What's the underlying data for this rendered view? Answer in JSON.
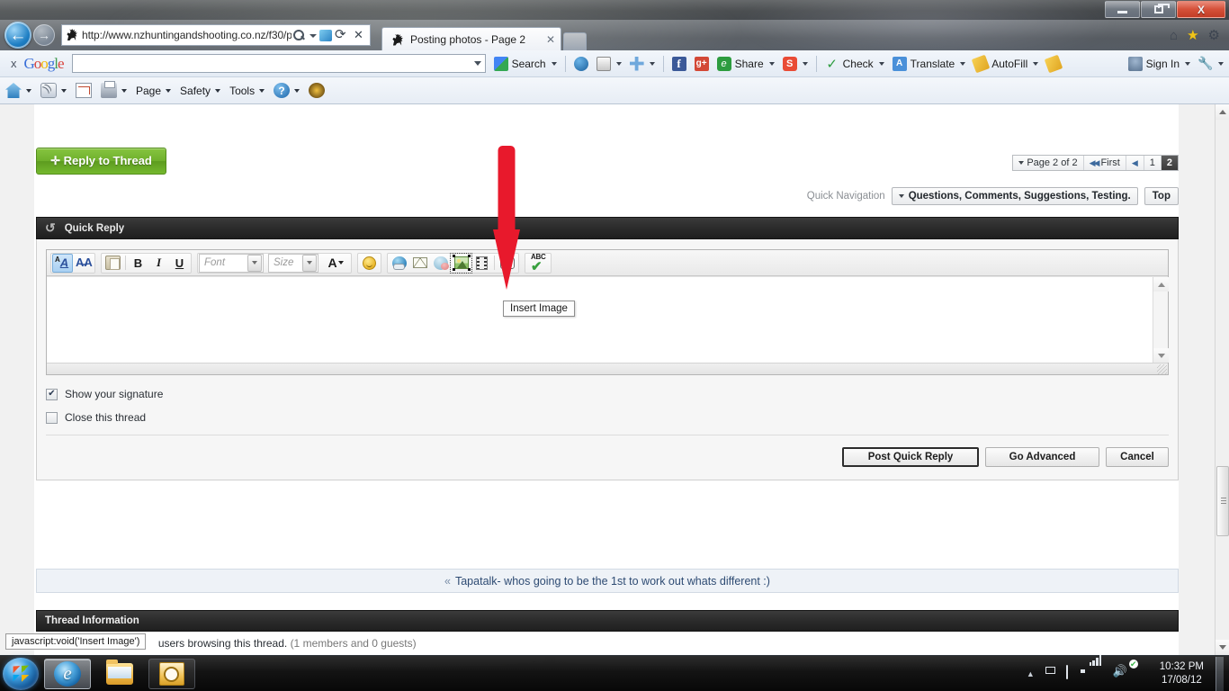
{
  "window": {
    "minimize_label": "Minimize",
    "restore_label": "Restore",
    "close_label": "X"
  },
  "browser": {
    "address_url": "http://www.nzhuntingandshooting.co.nz/f30/p",
    "address_domain": "nzhuntingandshooting.co.nz",
    "tab_title": "Posting photos - Page 2",
    "tab_close": "✕",
    "nav_back": "←",
    "nav_forward": "→"
  },
  "google_toolbar": {
    "close_x": "x",
    "logo": [
      "G",
      "o",
      "o",
      "g",
      "l",
      "e"
    ],
    "search_value": "",
    "search_label": "Search",
    "share_label": "Share",
    "check_label": "Check",
    "translate_label": "Translate",
    "autofill_label": "AutoFill",
    "signin_label": "Sign In"
  },
  "command_bar": {
    "page_label": "Page",
    "safety_label": "Safety",
    "tools_label": "Tools"
  },
  "thread": {
    "reply_button": "✛ Reply to Thread",
    "pagination": {
      "page_of": "Page 2 of 2",
      "first": "First",
      "pages": [
        "1",
        "2"
      ],
      "current_page": "2"
    },
    "quick_navigation": {
      "label": "Quick Navigation",
      "selected": "Questions, Comments, Suggestions, Testing.",
      "top_button": "Top"
    }
  },
  "quick_reply": {
    "title": "Quick Reply",
    "editor": {
      "font_placeholder": "Font",
      "size_placeholder": "Size",
      "textarea_value": "",
      "icons": [
        "font-color-icon",
        "remove-format-icon",
        "paste-icon",
        "bold-icon",
        "italic-icon",
        "underline-icon",
        "font-select",
        "size-select",
        "text-color-icon",
        "smiley-icon",
        "insert-link-icon",
        "insert-email-icon",
        "insert-attachment-icon",
        "insert-image-icon",
        "insert-video-icon",
        "insert-quote-icon",
        "spellcheck-icon"
      ],
      "bold": "B",
      "italic": "I",
      "underline": "U",
      "text_color_letter": "A",
      "spellcheck_label": "ABC"
    },
    "options": {
      "show_signature": "Show your signature",
      "show_signature_checked": true,
      "close_thread": "Close this thread",
      "close_thread_checked": false
    },
    "buttons": {
      "post": "Post Quick Reply",
      "advanced": "Go Advanced",
      "cancel": "Cancel"
    }
  },
  "tooltip": {
    "insert_image": "Insert Image"
  },
  "status_bar": {
    "text": "javascript:void('Insert Image')"
  },
  "tapatalk": {
    "chevron": "«",
    "text": "Tapatalk- whos going to be the 1st to work out whats different :)"
  },
  "thread_information": {
    "title": "Thread Information",
    "users_text": "users browsing this thread.",
    "detail": "(1 members and 0 guests)"
  },
  "taskbar": {
    "start": "start-orb",
    "items": [
      "internet-explorer",
      "windows-explorer",
      "microsoft-outlook"
    ],
    "clock_time": "10:32 PM",
    "clock_date": "17/08/12"
  },
  "annotation": {
    "arrow_color": "#e8192c",
    "points_at": "insert-image-icon"
  }
}
